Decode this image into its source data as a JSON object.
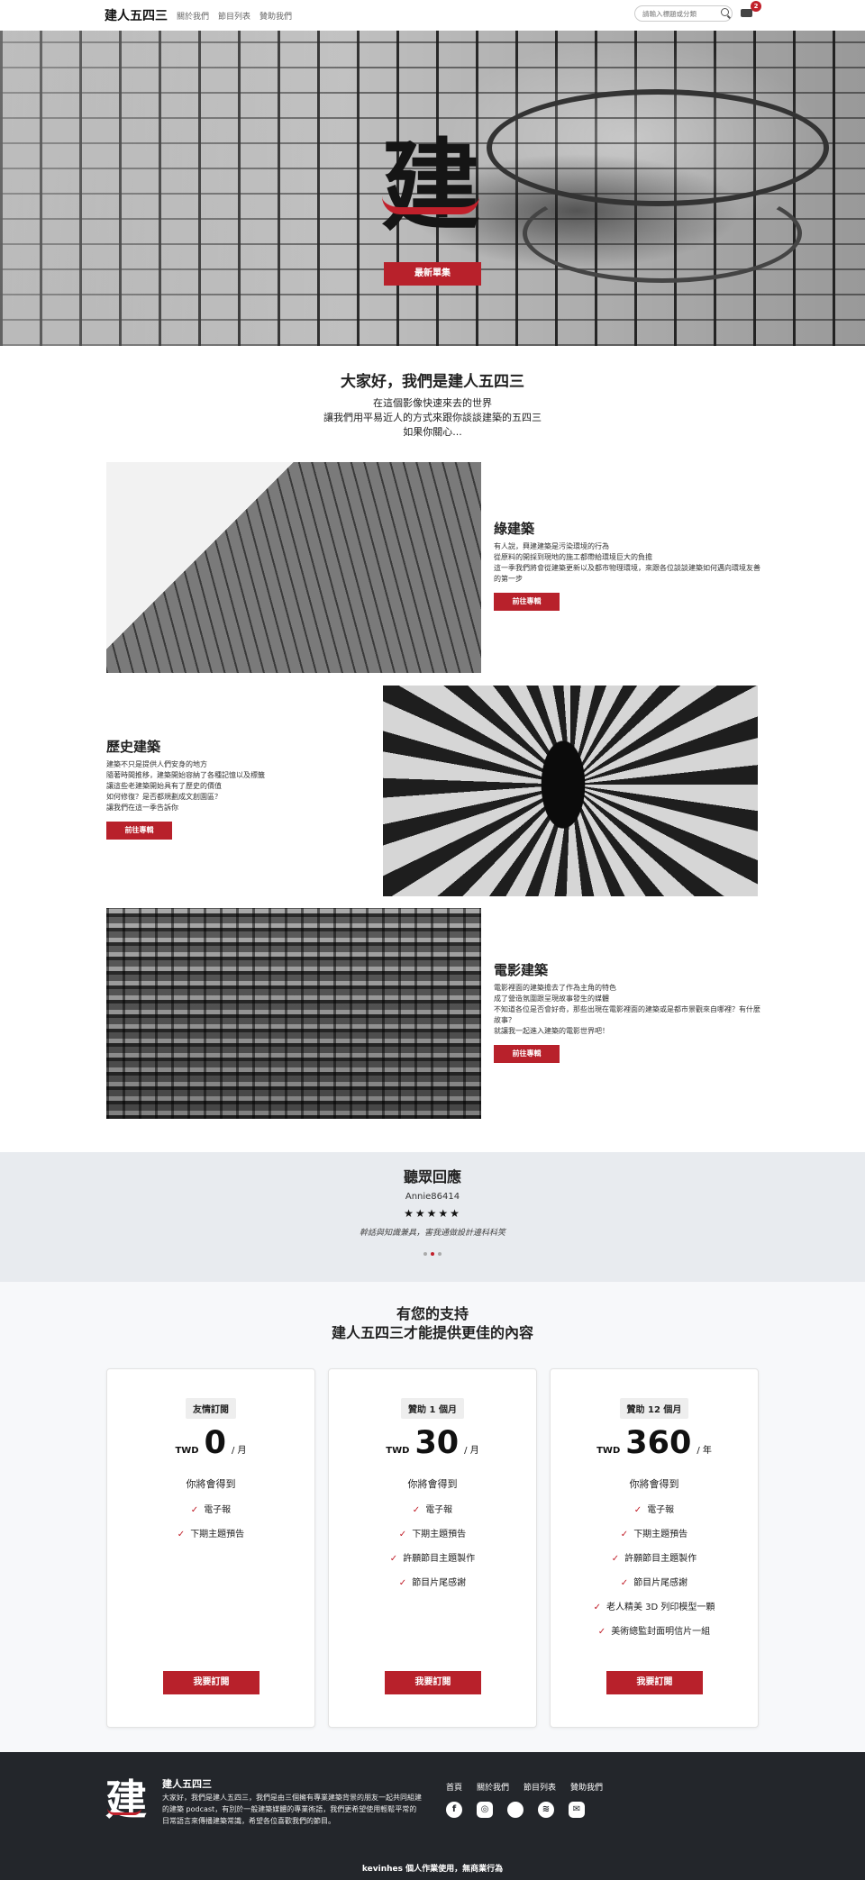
{
  "nav": {
    "brand": "建人五四三",
    "links": [
      "關於我們",
      "節目列表",
      "贊助我們"
    ],
    "search_placeholder": "請輸入標題或分類",
    "cart_count": "2"
  },
  "hero": {
    "logo_char": "建",
    "cta": "最新單集"
  },
  "intro": {
    "title": "大家好，我們是建人五四三",
    "lines": [
      "在這個影像快速來去的世界",
      "讓我們用平易近人的方式來跟你談談建築的五四三",
      "如果你關心..."
    ]
  },
  "features": [
    {
      "title": "綠建築",
      "lines": [
        "有人說，興建建築是污染環境的行為",
        "從原料的開採到現地的施工都帶給環境巨大的負擔",
        "這一季我們將會從建築更新以及都市物理環境，來跟各位談談建築如何邁向環境友善的第一步"
      ],
      "button": "前往專輯"
    },
    {
      "title": "歷史建築",
      "lines": [
        "建築不只是提供人們安身的地方",
        "隨著時間推移，建築開始容納了各種記憶以及標籤",
        "讓這些老建築開始具有了歷史的價值",
        "如何修復？是否都規劃成文創園區？",
        "讓我們在這一季告訴你"
      ],
      "button": "前往專輯"
    },
    {
      "title": "電影建築",
      "lines": [
        "電影裡面的建築擔去了作為主角的特色",
        "成了營造氛圍跟呈現故事發生的媒體",
        "不知道各位是否會好奇，那些出現在電影裡面的建築或是都市景觀來自哪裡？有什麼故事？",
        "就讓我一起進入建築的電影世界吧！"
      ],
      "button": "前往專輯"
    }
  ],
  "testimonials": {
    "title": "聽眾回應",
    "user": "Annie86414",
    "stars": "★★★★★",
    "rating": 5,
    "quote": "幹話與知識兼具，害我通做設計邊科科笑"
  },
  "plans": {
    "title_line1": "有您的支持",
    "title_line2": "建人五四三才能提供更佳的內容",
    "get_label": "你將會得到",
    "cards": [
      {
        "tag": "友情訂閱",
        "currency": "TWD",
        "price": "0",
        "period": "/ 月",
        "items": [
          "電子報",
          "下期主題預告"
        ],
        "button": "我要訂閱"
      },
      {
        "tag": "贊助 1 個月",
        "currency": "TWD",
        "price": "30",
        "period": "/ 月",
        "items": [
          "電子報",
          "下期主題預告",
          "許願節目主題製作",
          "節目片尾感謝"
        ],
        "button": "我要訂閱"
      },
      {
        "tag": "贊助 12 個月",
        "currency": "TWD",
        "price": "360",
        "period": "/ 年",
        "items": [
          "電子報",
          "下期主題預告",
          "許願節目主題製作",
          "節目片尾感謝",
          "老人精美 3D 列印模型一顆",
          "美術總監封面明信片一組"
        ],
        "button": "我要訂閱"
      }
    ]
  },
  "footer": {
    "logo_char": "建",
    "title": "建人五四三",
    "desc": "大家好，我們是建人五四三，我們是由三個擁有專業建築背景的朋友一起共同組建的建築 podcast，有別於一般建築媒體的專業術語，我們更希望使用輕鬆平常的日常語言來傳播建築常識，希望各位喜歡我們的節目。",
    "links": [
      "首頁",
      "關於我們",
      "節目列表",
      "贊助我們"
    ],
    "copyright": "kevinhes 個人作業使用，無商業行為"
  }
}
